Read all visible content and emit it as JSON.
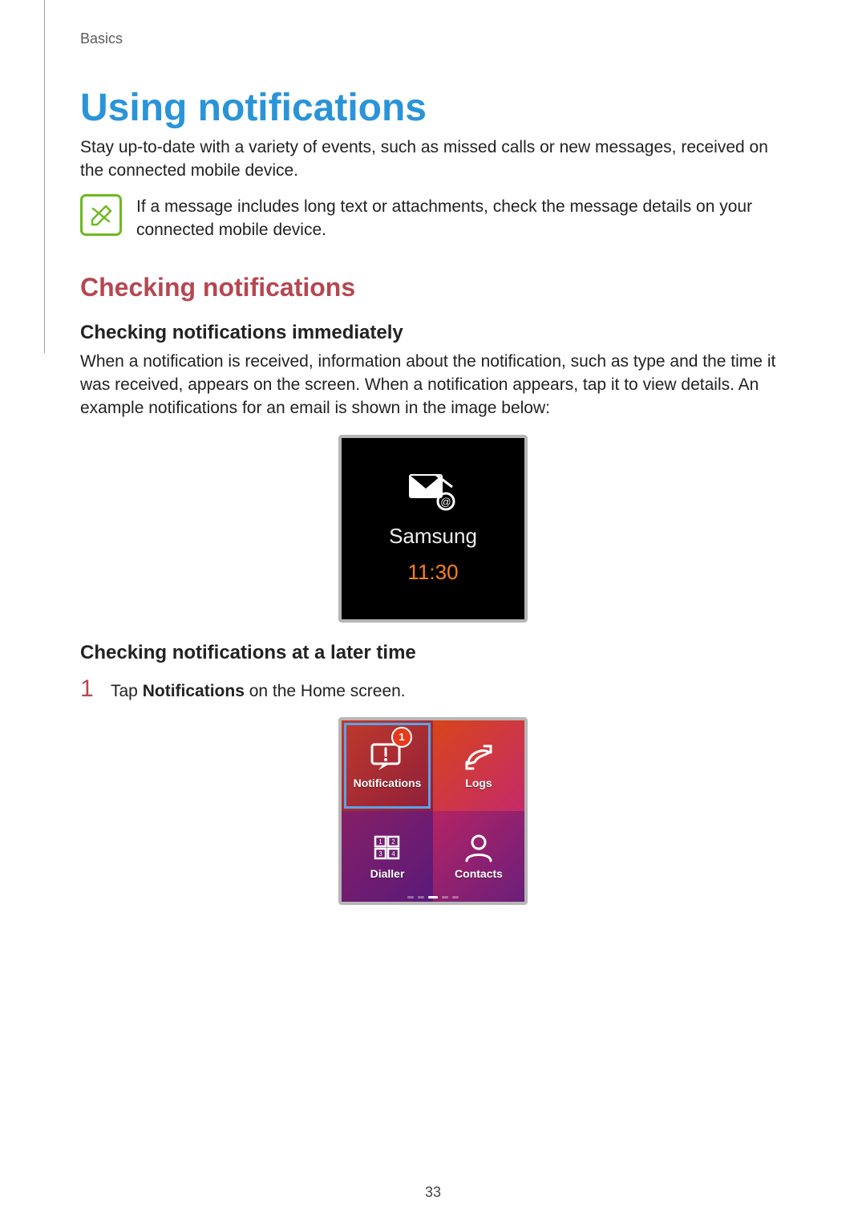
{
  "breadcrumb": "Basics",
  "heading1": "Using notifications",
  "intro_paragraph": "Stay up-to-date with a variety of events, such as missed calls or new messages, received on the connected mobile device.",
  "note_text": "If a message includes long text or attachments, check the message details on your connected mobile device.",
  "heading2": "Checking notifications",
  "heading3a": "Checking notifications immediately",
  "para_immediate": "When a notification is received, information about the notification, such as type and the time it was received, appears on the screen. When a notification appears, tap it to view details. An example notifications for an email is shown in the image below:",
  "email_shot": {
    "sender": "Samsung",
    "time": "11:30"
  },
  "heading3b": "Checking notifications at a later time",
  "step1": {
    "num": "1",
    "prefix": "Tap ",
    "strong": "Notifications",
    "suffix": " on the Home screen."
  },
  "home_tiles": {
    "notifications": "Notifications",
    "logs": "Logs",
    "dialler": "Dialler",
    "contacts": "Contacts",
    "badge": "1"
  },
  "page_number": "33"
}
